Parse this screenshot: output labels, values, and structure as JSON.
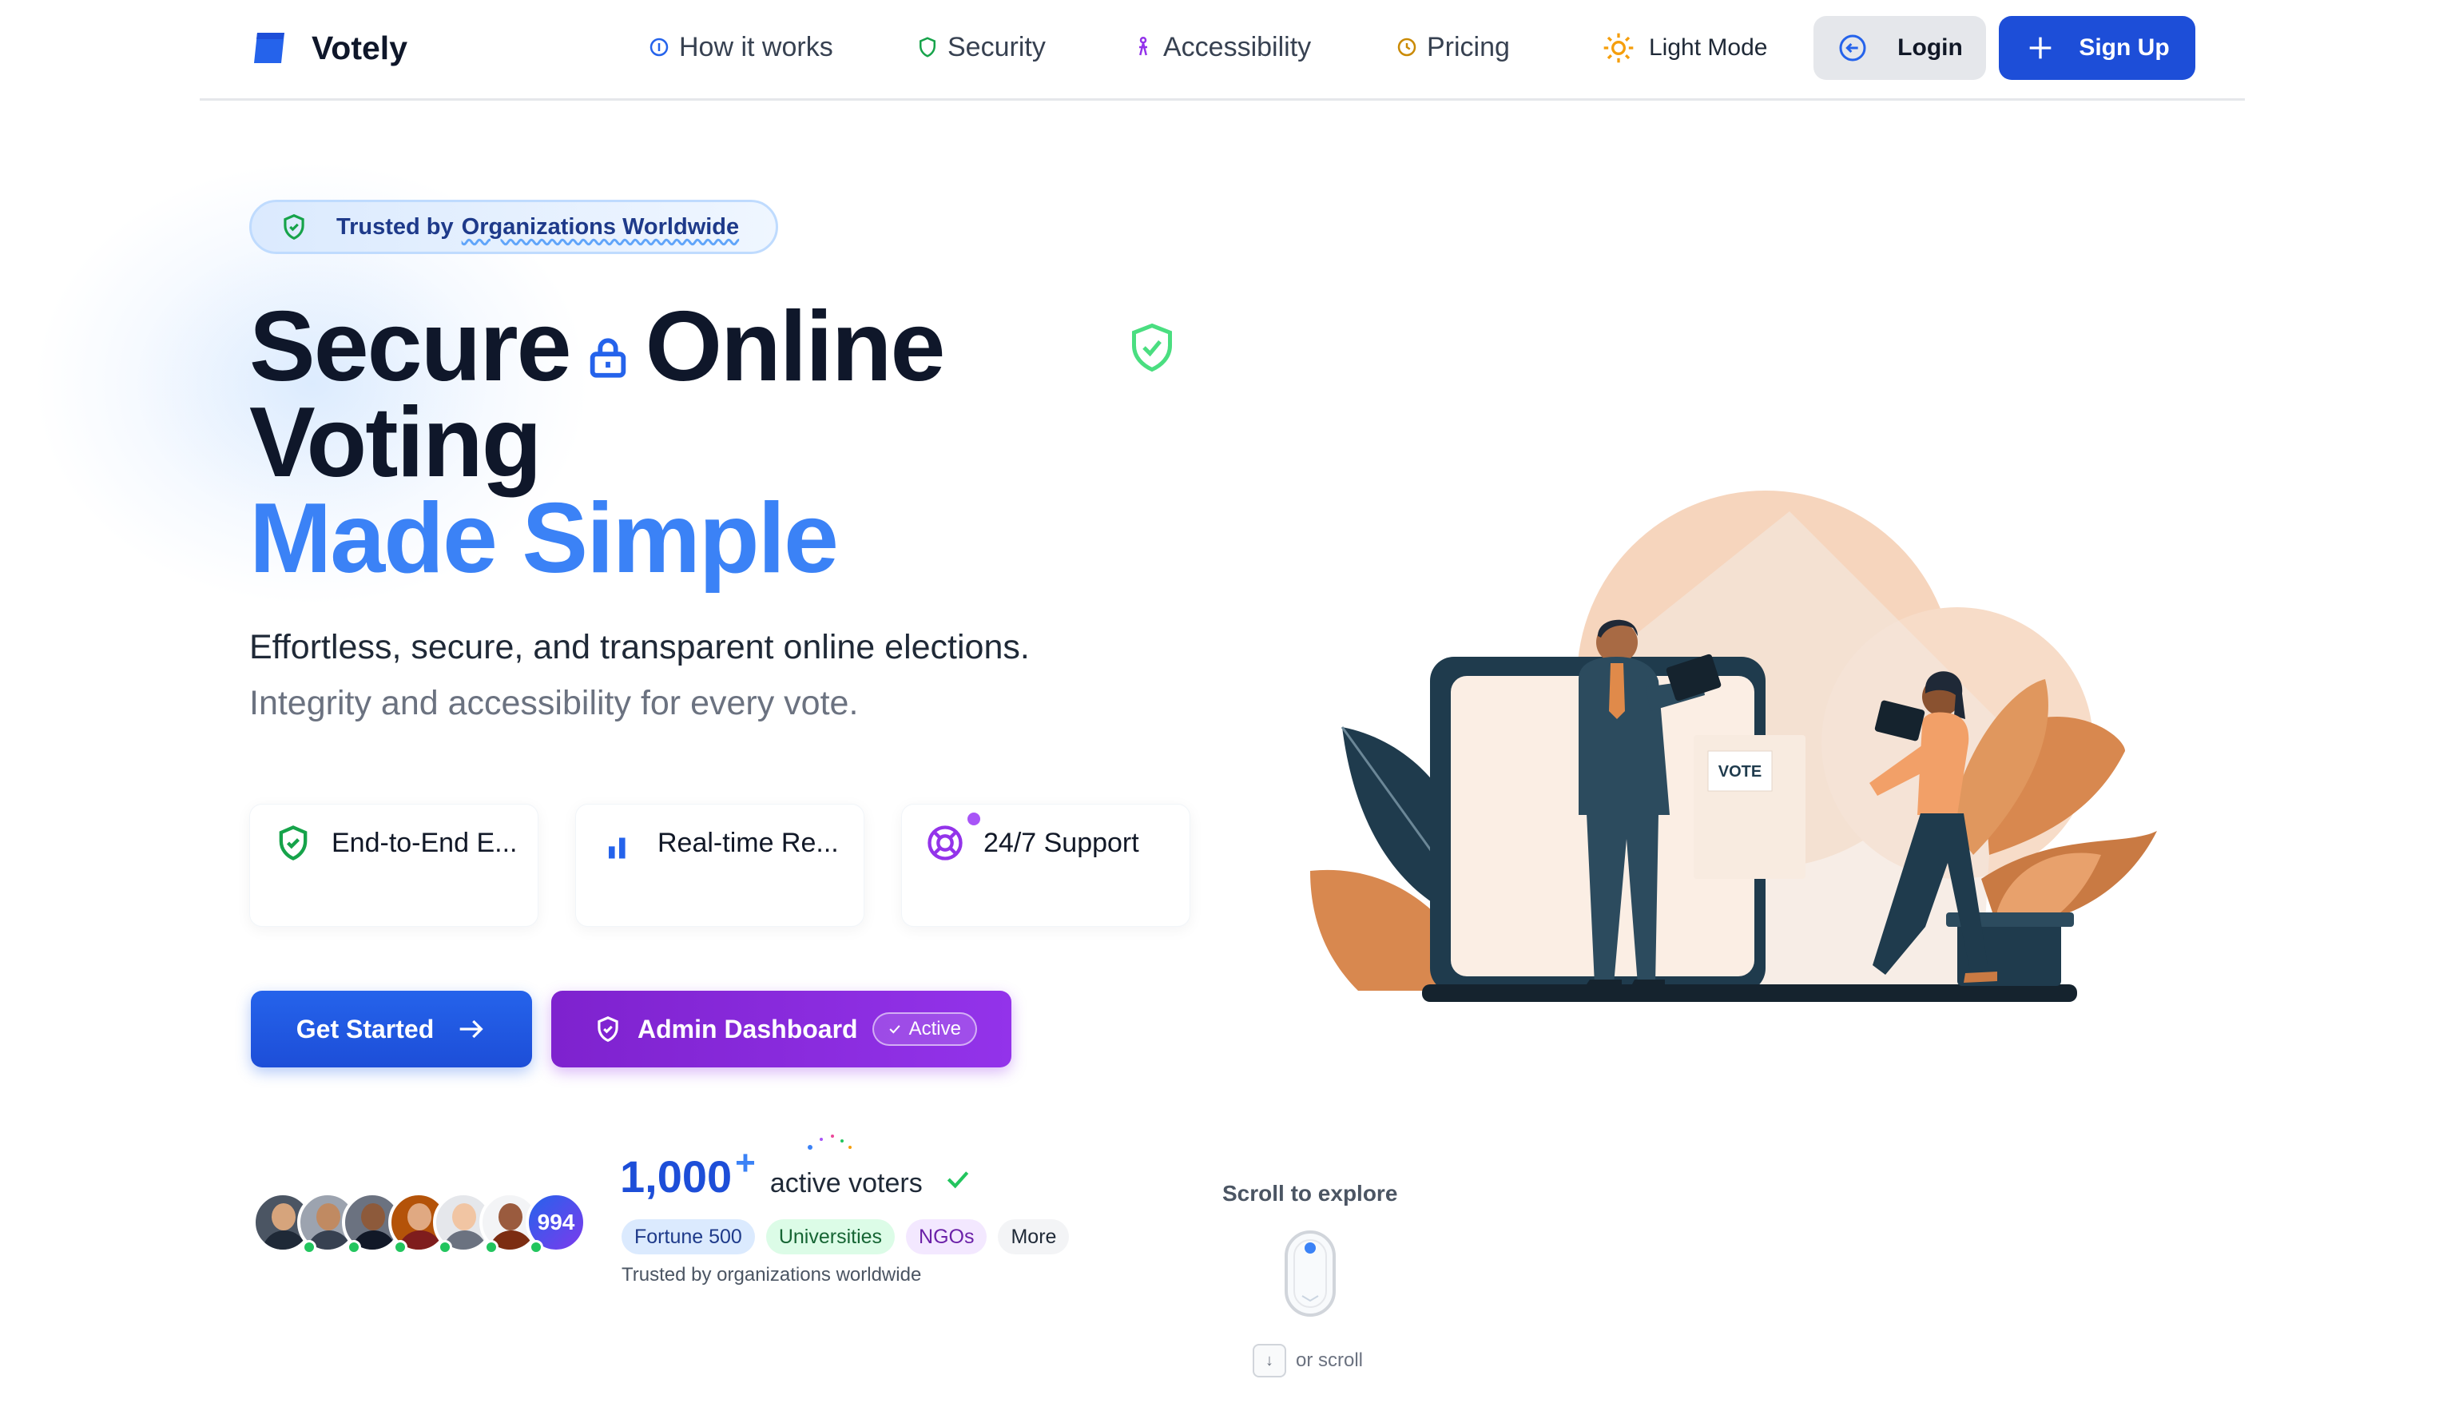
{
  "nav": {
    "brand": "Votely",
    "links": [
      {
        "label": "How it works",
        "icon": "info-icon"
      },
      {
        "label": "Security",
        "icon": "shield-icon"
      },
      {
        "label": "Accessibility",
        "icon": "accessibility-icon"
      },
      {
        "label": "Pricing",
        "icon": "clock-icon"
      }
    ],
    "theme_toggle": "Light Mode",
    "login": "Login",
    "signup": "Sign Up"
  },
  "hero": {
    "trust_prefix": "Trusted by",
    "trust_highlight": "Organizations Worldwide",
    "headline_1a": "Secure",
    "headline_1b": "Online",
    "headline_2": "Voting",
    "headline_3": "Made Simple",
    "subtitle_1": "Effortless, secure, and transparent online elections.",
    "subtitle_2": "Integrity and accessibility for every vote."
  },
  "features": [
    {
      "label": "End-to-End E...",
      "icon": "shield-check-icon"
    },
    {
      "label": "Real-time Re...",
      "icon": "bar-chart-icon"
    },
    {
      "label": "24/7 Support",
      "icon": "lifebuoy-icon"
    }
  ],
  "cta": {
    "get_started": "Get Started",
    "admin_dashboard": "Admin Dashboard",
    "admin_badge": "Active"
  },
  "social_proof": {
    "avatar_count": "994",
    "voters_number": "1,000",
    "voters_plus": "+",
    "voters_label": "active voters",
    "chips": [
      "Fortune 500",
      "Universities",
      "NGOs",
      "More"
    ],
    "trusted_text": "Trusted by organizations worldwide"
  },
  "scroll": {
    "label": "Scroll to explore",
    "key": "↓",
    "hint": "or scroll"
  },
  "illustration": {
    "ballot_box_text": "VOTE"
  },
  "colors": {
    "primary": "#1d4ed8",
    "accent_blue": "#3b82f6",
    "purple": "#9333ea",
    "green": "#22c55e",
    "peach": "#f6d5bd",
    "dark_teal": "#1f3b4d",
    "leaf_orange": "#d8884f"
  }
}
